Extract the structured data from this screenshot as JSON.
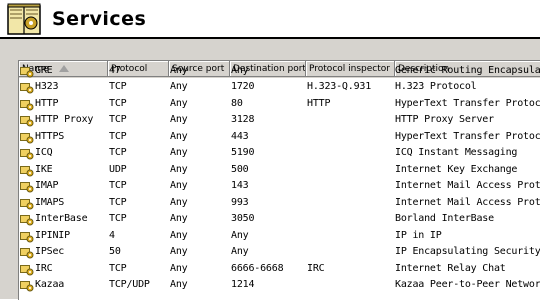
{
  "header": {
    "title": "Services",
    "icon": "services-book-icon"
  },
  "columns": [
    {
      "key": "name",
      "label": "Name"
    },
    {
      "key": "protocol",
      "label": "Protocol"
    },
    {
      "key": "source_port",
      "label": "Source port"
    },
    {
      "key": "destination_port",
      "label": "Destination port"
    },
    {
      "key": "protocol_inspector",
      "label": "Protocol inspector"
    },
    {
      "key": "description",
      "label": "Description"
    }
  ],
  "partial_row": {
    "name": "GRE",
    "protocol": "47",
    "source_port": "Any",
    "destination_port": "Any",
    "protocol_inspector": "",
    "description": "Generic Routing Encapsulation"
  },
  "rows": [
    {
      "name": "H323",
      "protocol": "TCP",
      "source_port": "Any",
      "destination_port": "1720",
      "protocol_inspector": "H.323-Q.931",
      "description": "H.323 Protocol"
    },
    {
      "name": "HTTP",
      "protocol": "TCP",
      "source_port": "Any",
      "destination_port": "80",
      "protocol_inspector": "HTTP",
      "description": "HyperText Transfer Protocol - WW"
    },
    {
      "name": "HTTP Proxy",
      "protocol": "TCP",
      "source_port": "Any",
      "destination_port": "3128",
      "protocol_inspector": "",
      "description": "HTTP Proxy Server"
    },
    {
      "name": "HTTPS",
      "protocol": "TCP",
      "source_port": "Any",
      "destination_port": "443",
      "protocol_inspector": "",
      "description": "HyperText Transfer Protocol - Sec"
    },
    {
      "name": "ICQ",
      "protocol": "TCP",
      "source_port": "Any",
      "destination_port": "5190",
      "protocol_inspector": "",
      "description": "ICQ Instant Messaging"
    },
    {
      "name": "IKE",
      "protocol": "UDP",
      "source_port": "Any",
      "destination_port": "500",
      "protocol_inspector": "",
      "description": "Internet Key Exchange"
    },
    {
      "name": "IMAP",
      "protocol": "TCP",
      "source_port": "Any",
      "destination_port": "143",
      "protocol_inspector": "",
      "description": "Internet Mail Access Protocol"
    },
    {
      "name": "IMAPS",
      "protocol": "TCP",
      "source_port": "Any",
      "destination_port": "993",
      "protocol_inspector": "",
      "description": "Internet Mail Access Protocol - Sec"
    },
    {
      "name": "InterBase",
      "protocol": "TCP",
      "source_port": "Any",
      "destination_port": "3050",
      "protocol_inspector": "",
      "description": "Borland InterBase"
    },
    {
      "name": "IPINIP",
      "protocol": "4",
      "source_port": "Any",
      "destination_port": "Any",
      "protocol_inspector": "",
      "description": "IP in IP"
    },
    {
      "name": "IPSec",
      "protocol": "50",
      "source_port": "Any",
      "destination_port": "Any",
      "protocol_inspector": "",
      "description": "IP Encapsulating Security Payload"
    },
    {
      "name": "IRC",
      "protocol": "TCP",
      "source_port": "Any",
      "destination_port": "6666-6668",
      "protocol_inspector": "IRC",
      "description": "Internet Relay Chat"
    },
    {
      "name": "Kazaa",
      "protocol": "TCP/UDP",
      "source_port": "Any",
      "destination_port": "1214",
      "protocol_inspector": "",
      "description": "Kazaa Peer-to-Peer Network"
    }
  ],
  "colors": {
    "panel": "#d6d3ce",
    "header_bg": "#d6d3ce",
    "row_bg": "#ffffff"
  }
}
